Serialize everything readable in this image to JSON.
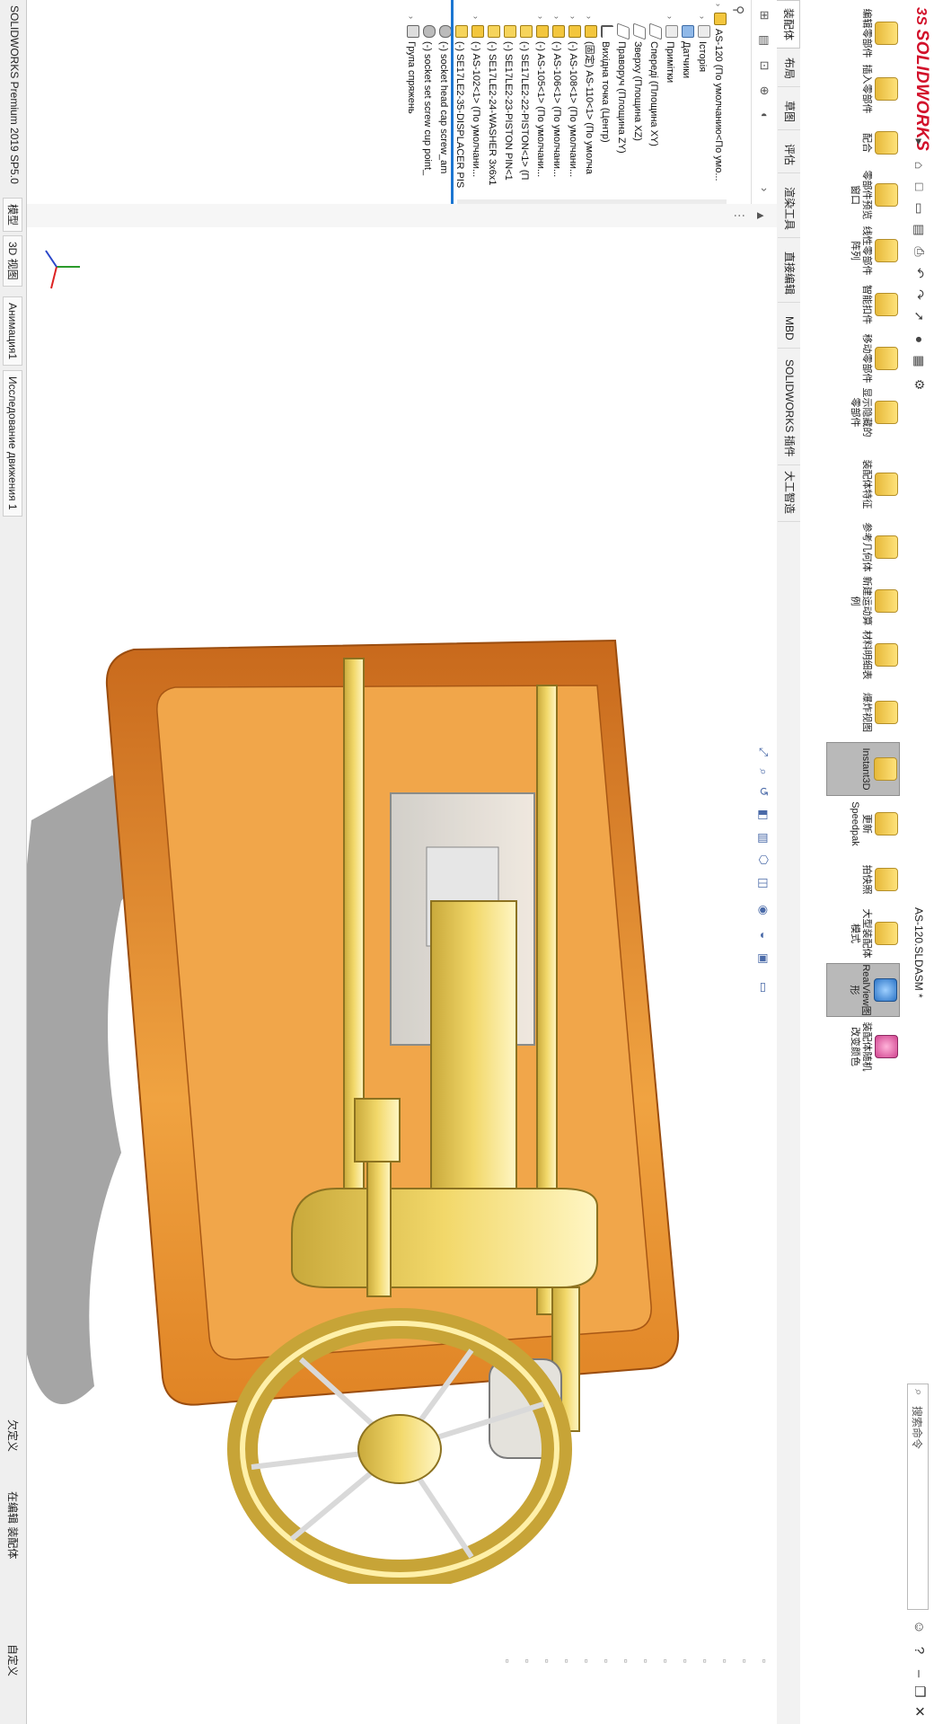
{
  "app": {
    "brand_prefix": "3S",
    "brand_name": "SOLIDWORKS",
    "filename": "AS-120.SLDASM *",
    "search_placeholder": "搜索命令",
    "status_text": "SOLIDWORKS Premium 2019 SP5.0",
    "status_state_1": "欠定义",
    "status_state_2": "在编辑 装配体",
    "status_custom": "自定义"
  },
  "ribbon": {
    "buttons": [
      "编辑零部件",
      "插入零部件",
      "配合",
      "零部件预览窗口",
      "线性零部件阵列",
      "智能扣件",
      "移动零部件",
      "显示隐藏的零部件",
      "装配体特征",
      "参考几何体",
      "新建运动算例",
      "材料明细表",
      "爆炸视图",
      "Instant3D",
      "更新Speedpak",
      "拍快照",
      "大型装配体模式",
      "RealView图形",
      "装配体随机改变颜色"
    ]
  },
  "tabs": [
    "装配体",
    "布局",
    "草图",
    "评估",
    "渲染工具",
    "直接编辑",
    "MBD",
    "SOLIDWORKS 插件",
    "大工智造"
  ],
  "tree": [
    {
      "label": "AS-120 (По умолчанию<По умо...",
      "type": "asm",
      "level": 0
    },
    {
      "label": "Історія",
      "type": "folder",
      "level": 1
    },
    {
      "label": "Датчики",
      "type": "sensor",
      "level": 1
    },
    {
      "label": "Примітки",
      "type": "folder",
      "level": 1
    },
    {
      "label": "Спереді (Площина XY)",
      "type": "plane",
      "level": 1
    },
    {
      "label": "Зверху (Площина XZ)",
      "type": "plane",
      "level": 1
    },
    {
      "label": "Праворуч (Площина ZY)",
      "type": "plane",
      "level": 1
    },
    {
      "label": "Вихідна точка (Центр)",
      "type": "origin",
      "level": 1
    },
    {
      "label": "(固定) AS-110<1> (По умолча",
      "type": "asm",
      "level": 1
    },
    {
      "label": "(-) AS-108<1> (По умолчани...",
      "type": "asm",
      "level": 1
    },
    {
      "label": "(-) AS-106<1> (По умолчани...",
      "type": "asm",
      "level": 1
    },
    {
      "label": "(-) AS-105<1> (По умолчани...",
      "type": "asm",
      "level": 1
    },
    {
      "label": "(-) SE17LE2-22-PISTON<1> (П",
      "type": "part",
      "level": 1
    },
    {
      "label": "(-) SE17LE2-23-PISTON PIN<1",
      "type": "part",
      "level": 1
    },
    {
      "label": "(-) SE17LE2-24-WASHER 3x6x1",
      "type": "part",
      "level": 1
    },
    {
      "label": "(-) AS-102<1> (По умолчани...",
      "type": "asm",
      "level": 1
    },
    {
      "label": "(-) SE17LE2-35-DISPLACER PIS",
      "type": "part",
      "level": 1
    },
    {
      "label": "(-) socket head cap screw_am",
      "type": "hw",
      "level": 1
    },
    {
      "label": "(-) socket set screw cup point_",
      "type": "hw",
      "level": 1
    },
    {
      "label": "Група спряжень",
      "type": "mate",
      "level": 1
    }
  ],
  "bottom_tabs": [
    "模型",
    "3D 视图",
    "Анимация1",
    "Исследование движения 1"
  ],
  "colors": {
    "brand": "#d2102a",
    "selection": "#1b76d2",
    "brass": "#f2d86a",
    "wood": "#e8902e"
  }
}
